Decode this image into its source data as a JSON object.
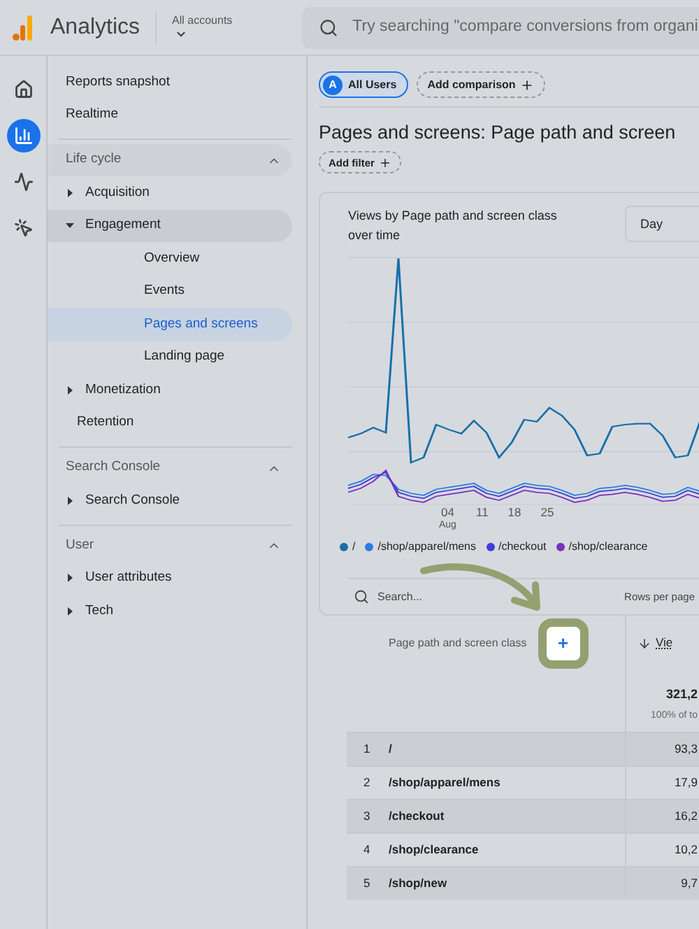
{
  "header": {
    "product": "Analytics",
    "account": "All accounts",
    "search_placeholder": "Try searching \"compare conversions from organi"
  },
  "rail": [
    {
      "kind": "home",
      "selected": false
    },
    {
      "kind": "reports",
      "selected": true
    },
    {
      "kind": "explore",
      "selected": false
    },
    {
      "kind": "advertising",
      "selected": false
    }
  ],
  "sidebar": {
    "top_items": [
      {
        "label": "Reports snapshot",
        "selected": false
      },
      {
        "label": "Realtime",
        "selected": false
      }
    ],
    "sections": [
      {
        "title": "Life cycle",
        "expanded": true,
        "items": [
          {
            "label": "Acquisition",
            "expanded": false,
            "selected": false
          },
          {
            "label": "Engagement",
            "expanded": true,
            "selected": false,
            "children": [
              {
                "label": "Overview",
                "selected": false
              },
              {
                "label": "Events",
                "selected": false
              },
              {
                "label": "Pages and screens",
                "selected": true
              },
              {
                "label": "Landing page",
                "selected": false
              }
            ]
          },
          {
            "label": "Monetization",
            "expanded": false,
            "selected": false
          },
          {
            "label": "Retention",
            "selected": false
          }
        ]
      },
      {
        "title": "Search Console",
        "expanded": true,
        "items": [
          {
            "label": "Search Console",
            "expanded": false,
            "selected": false
          }
        ]
      },
      {
        "title": "User",
        "expanded": true,
        "items": [
          {
            "label": "User attributes",
            "expanded": false,
            "selected": false
          },
          {
            "label": "Tech",
            "expanded": false,
            "selected": false
          }
        ]
      }
    ]
  },
  "comparison": {
    "segment_badge": "A",
    "segment": "All Users",
    "add_comparison": "Add comparison"
  },
  "page_title": "Pages and screens: Page path and screen",
  "add_filter": "Add filter",
  "chart_card": {
    "title": "Views by Page path and screen class over time",
    "interval": "Day",
    "x_labels": [
      {
        "label": "04",
        "sub": "Aug"
      },
      {
        "label": "11"
      },
      {
        "label": "18"
      },
      {
        "label": "25"
      }
    ],
    "legend": [
      {
        "label": "/",
        "color": "#1a6fa8"
      },
      {
        "label": "/shop/apparel/mens",
        "color": "#2a7de1"
      },
      {
        "label": "/checkout",
        "color": "#3c3fd6"
      },
      {
        "label": "/shop/clearance",
        "color": "#7a2fc0"
      }
    ]
  },
  "table": {
    "search_placeholder": "Search...",
    "rows_per_page": "Rows per page",
    "dimension_header": "Page path and screen class",
    "add_dimension": "+",
    "metric_header": "Vie",
    "total": "321,2",
    "total_note": "100% of to",
    "rows": [
      {
        "index": "1",
        "path": "/",
        "value": "93,3"
      },
      {
        "index": "2",
        "path": "/shop/apparel/mens",
        "value": "17,9"
      },
      {
        "index": "3",
        "path": "/checkout",
        "value": "16,2"
      },
      {
        "index": "4",
        "path": "/shop/clearance",
        "value": "10,2"
      },
      {
        "index": "5",
        "path": "/shop/new",
        "value": "9,7"
      }
    ]
  }
}
